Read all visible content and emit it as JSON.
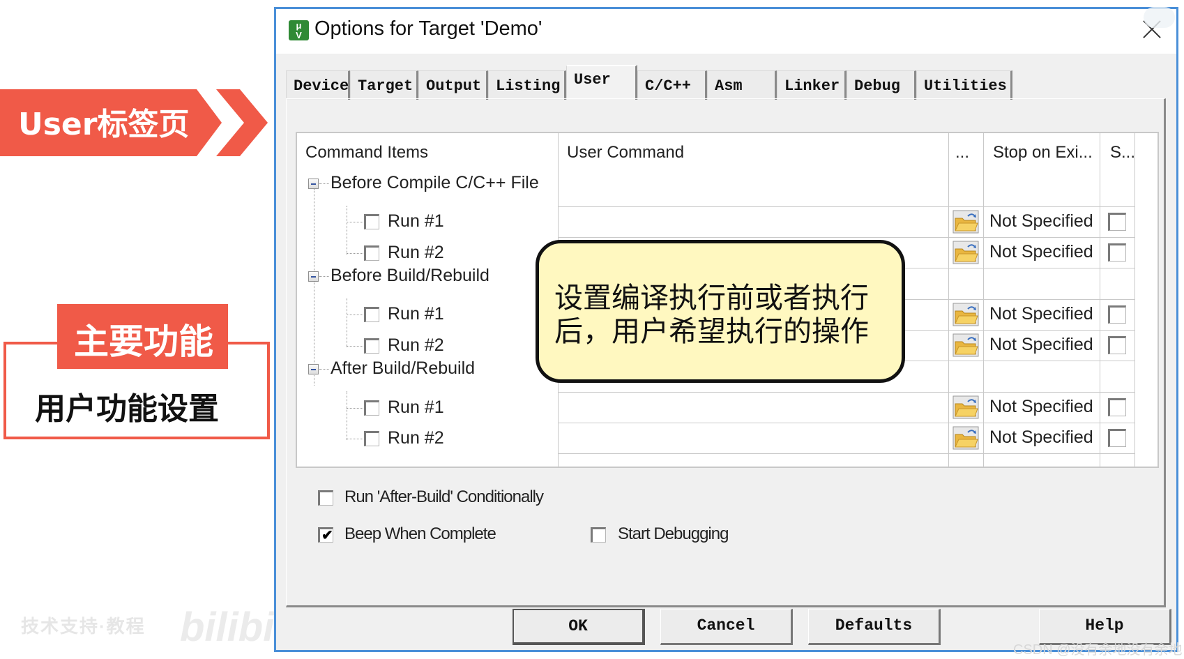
{
  "annotations": {
    "banner_label": "User标签页",
    "function_tag": "主要功能",
    "function_text": "用户功能设置",
    "callout_text": "设置编译执行前或者执行后，用户希望执行的操作",
    "accent_color": "#f05a48",
    "callout_bg": "#fff8c0"
  },
  "watermarks": {
    "bilibili": "bilibili",
    "bottom_left": "技术支持·教程",
    "csdn": "CSDN @没有余地没有余地"
  },
  "dialog": {
    "title": "Options for Target 'Demo'",
    "icon": "keil-uvision-icon",
    "close_icon": "close-icon",
    "tabs": [
      {
        "label": "Device",
        "active": false
      },
      {
        "label": "Target",
        "active": false
      },
      {
        "label": "Output",
        "active": false
      },
      {
        "label": "Listing",
        "active": false
      },
      {
        "label": "User",
        "active": true
      },
      {
        "label": "C/C++",
        "active": false
      },
      {
        "label": "Asm",
        "active": false
      },
      {
        "label": "Linker",
        "active": false
      },
      {
        "label": "Debug",
        "active": false
      },
      {
        "label": "Utilities",
        "active": false
      }
    ],
    "table": {
      "headers": {
        "command_items": "Command Items",
        "user_command": "User Command",
        "browse": "...",
        "stop_on_exit": "Stop on Exi...",
        "s": "S..."
      },
      "groups": [
        {
          "label": "Before Compile C/C++ File",
          "expanded": true,
          "runs": [
            {
              "label": "Run #1",
              "checked": false,
              "command": "",
              "stop_on_exit": "Not Specified",
              "s_checked": false
            },
            {
              "label": "Run #2",
              "checked": false,
              "command": "",
              "stop_on_exit": "Not Specified",
              "s_checked": false
            }
          ]
        },
        {
          "label": "Before Build/Rebuild",
          "expanded": true,
          "runs": [
            {
              "label": "Run #1",
              "checked": false,
              "command": "",
              "stop_on_exit": "Not Specified",
              "s_checked": false
            },
            {
              "label": "Run #2",
              "checked": false,
              "command": "",
              "stop_on_exit": "Not Specified",
              "s_checked": false
            }
          ]
        },
        {
          "label": "After Build/Rebuild",
          "expanded": true,
          "runs": [
            {
              "label": "Run #1",
              "checked": false,
              "command": "",
              "stop_on_exit": "Not Specified",
              "s_checked": false
            },
            {
              "label": "Run #2",
              "checked": false,
              "command": "",
              "stop_on_exit": "Not Specified",
              "s_checked": false
            }
          ]
        }
      ]
    },
    "options": {
      "run_after_build_conditionally": {
        "label": "Run 'After-Build' Conditionally",
        "checked": false
      },
      "beep_when_complete": {
        "label": "Beep When Complete",
        "checked": true
      },
      "start_debugging": {
        "label": "Start Debugging",
        "checked": false
      }
    },
    "buttons": {
      "ok": "OK",
      "cancel": "Cancel",
      "defaults": "Defaults",
      "help": "Help"
    }
  }
}
